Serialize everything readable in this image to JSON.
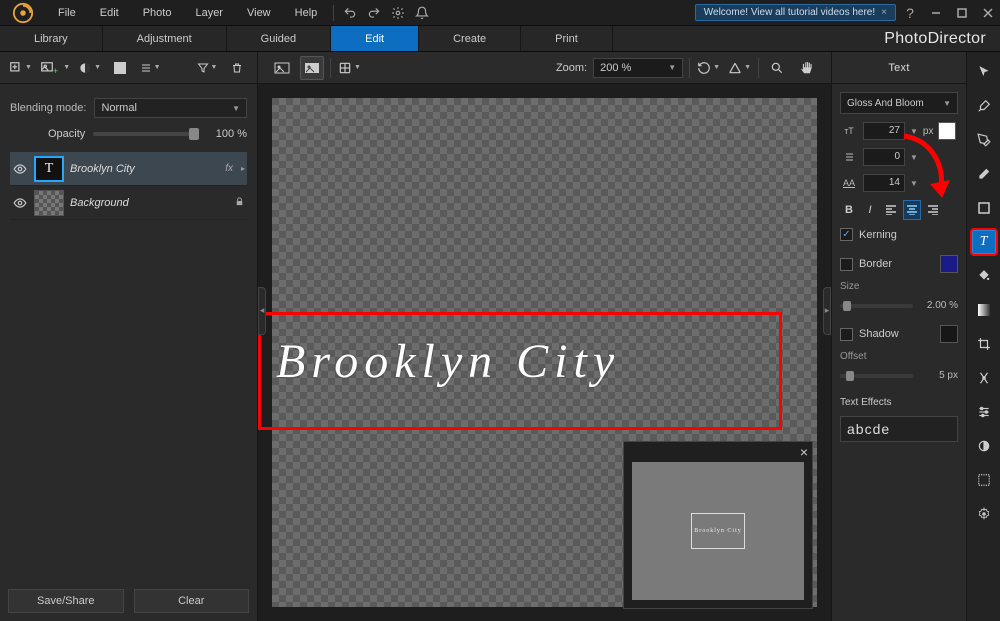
{
  "menu": {
    "items": [
      "File",
      "Edit",
      "Photo",
      "Layer",
      "View",
      "Help"
    ]
  },
  "welcome": "Welcome! View all tutorial videos here!",
  "tabs": [
    "Library",
    "Adjustment",
    "Guided",
    "Edit",
    "Create",
    "Print"
  ],
  "active_tab": "Edit",
  "brand": "PhotoDirector",
  "left": {
    "blending_label": "Blending mode:",
    "blending_value": "Normal",
    "opacity_label": "Opacity",
    "opacity_value": "100 %",
    "layers": [
      {
        "name": "Brooklyn City",
        "fx": "fx",
        "type": "text",
        "selected": true
      },
      {
        "name": "Background",
        "locked": true,
        "type": "bg"
      }
    ],
    "save_share": "Save/Share",
    "clear": "Clear"
  },
  "center": {
    "zoom_label": "Zoom:",
    "zoom_value": "200 %",
    "canvas_text": "Brooklyn City",
    "nav_preview_text": "Brooklyn City"
  },
  "right": {
    "header": "Text",
    "font": "Gloss And Bloom",
    "font_size": "27",
    "font_unit": "px",
    "line_val": "0",
    "tracking_val": "14",
    "kerning_label": "Kerning",
    "border_label": "Border",
    "size_label": "Size",
    "size_value": "2.00 %",
    "shadow_label": "Shadow",
    "offset_label": "Offset",
    "offset_value": "5 px",
    "text_effects_label": "Text Effects",
    "text_effects_preview": "abcde",
    "colors": {
      "fill": "#ffffff",
      "border": "#1a1a8a",
      "shadow": "#171717"
    }
  }
}
